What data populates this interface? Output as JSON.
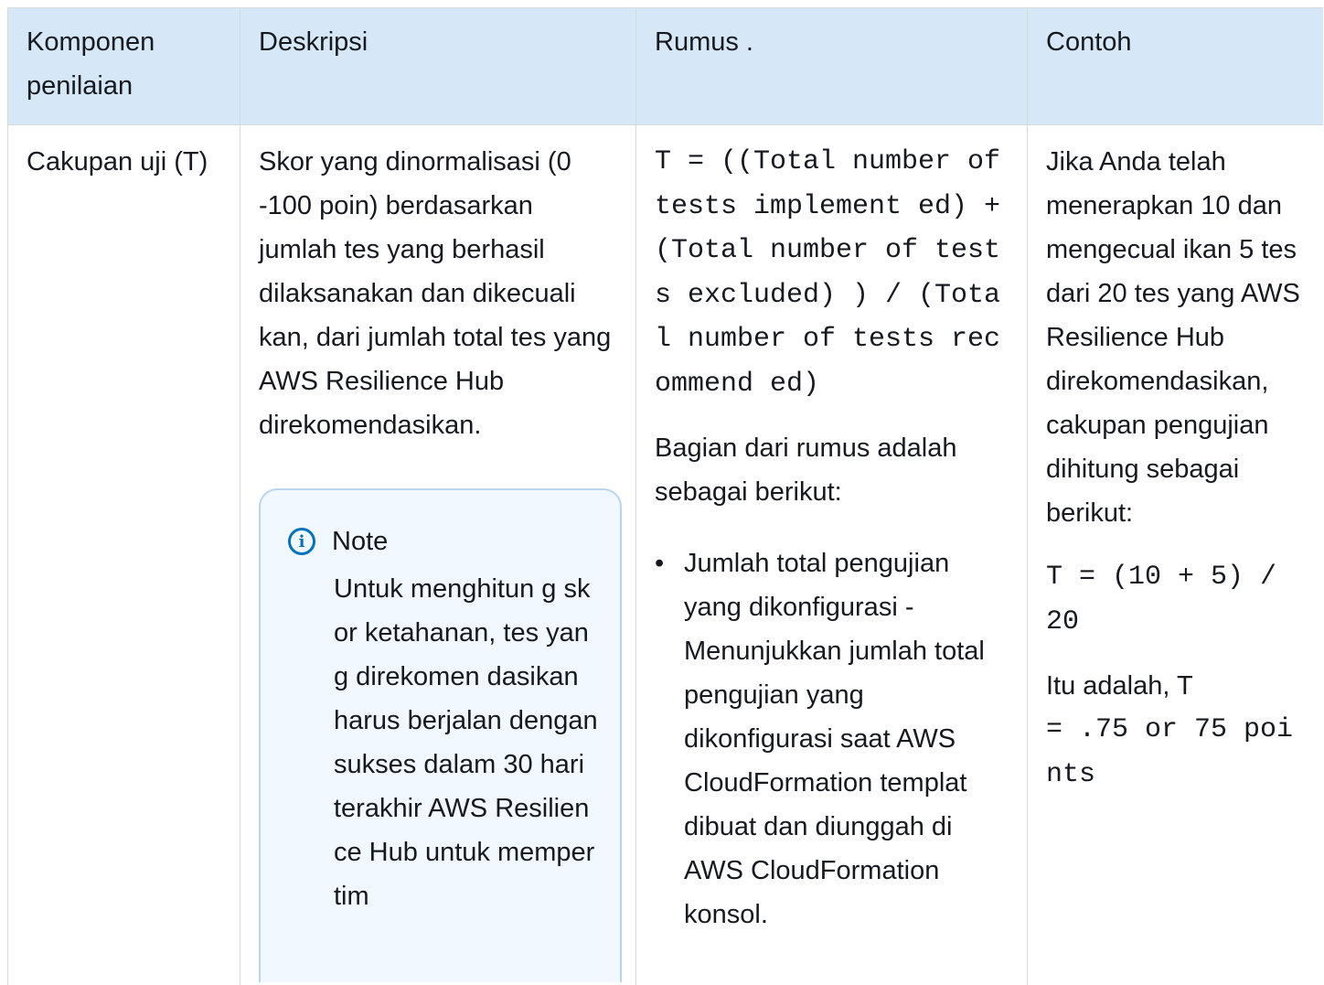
{
  "table": {
    "headers": [
      "Komponen penilaian",
      "Deskripsi",
      "Rumus .",
      "Contoh"
    ],
    "row": {
      "component": "Cakupan uji (T)",
      "description": "Skor yang dinormalisasi (0 -100 poin) berdasarkan jumlah tes yang berhasil dilaksanakan dan dikecuali kan, dari jumlah total tes yang AWS Resilience Hub direkomendasikan.",
      "note": {
        "title": "Note",
        "body": "Untuk menghitun g skor ketahanan, tes yang direkomen dasikan harus berjalan dengan sukses dalam 30 hari terakhir AWS Resilience Hub untuk mempertim"
      },
      "formula_code": "T = ((Total number of tests implement ed) + (Total number of tests excluded) ) / (Total number of tests recommend ed)",
      "formula_intro": "Bagian dari rumus adalah sebagai berikut:",
      "formula_items": [
        "Jumlah total pengujian yang dikonfigurasi - Menunjukkan jumlah total pengujian yang dikonfigurasi saat AWS CloudFormation templat dibuat dan diunggah di AWS CloudFormation konsol."
      ],
      "example_text": "Jika Anda telah menerapkan 10 dan mengecual ikan 5 tes dari 20 tes yang AWS Resilience Hub direkomendasikan, cakupan pengujian dihitung sebagai berikut:",
      "example_code": "T = (10 + 5) / 20",
      "example_result_prefix": "Itu adalah, T",
      "example_result_code": "= .75 or 75 points"
    }
  }
}
